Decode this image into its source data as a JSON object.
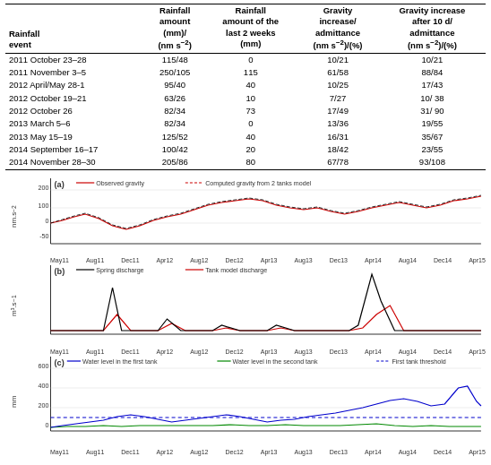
{
  "table": {
    "headers": [
      {
        "line1": "Rainfall",
        "line2": "event"
      },
      {
        "line1": "Rainfall",
        "line2": "amount",
        "line3": "(mm)/",
        "line4": "(nm s⁻²)"
      },
      {
        "line1": "Rainfall",
        "line2": "amount of the",
        "line3": "last 2 weeks",
        "line4": "(mm)"
      },
      {
        "line1": "Gravity",
        "line2": "increase/",
        "line3": "admittance",
        "line4": "(nm s⁻²)/(%)"
      },
      {
        "line1": "Gravity increase",
        "line2": "after 10 d/",
        "line3": "admittance",
        "line4": "(nm s⁻²)/(%)"
      }
    ],
    "rows": [
      [
        "2011 October 23–28",
        "115/48",
        "0",
        "10/21",
        "10/21"
      ],
      [
        "2011 November 3–5",
        "250/105",
        "115",
        "61/58",
        "88/84"
      ],
      [
        "2012 April/May 28-1",
        "95/40",
        "40",
        "10/25",
        "17/43"
      ],
      [
        "2012 October 19–21",
        "63/26",
        "10",
        "7/27",
        "10/ 38"
      ],
      [
        "2012 October 26",
        "82/34",
        "73",
        "17/49",
        "31/ 90"
      ],
      [
        "2013 March 5–6",
        "82/34",
        "0",
        "13/36",
        "19/55"
      ],
      [
        "2013 May 15–19",
        "125/52",
        "40",
        "16/31",
        "35/67"
      ],
      [
        "2014 September 16–17",
        "100/42",
        "20",
        "18/42",
        "23/55"
      ],
      [
        "2014 November 28–30",
        "205/86",
        "80",
        "67/78",
        "93/108"
      ]
    ]
  },
  "charts": {
    "a": {
      "label": "(a)",
      "y_axis": "nm.s⁻²",
      "y_max": 200,
      "y_min": -50,
      "legend": [
        {
          "color": "#cc0000",
          "label": "Observed gravity"
        },
        {
          "color": "#cc0000",
          "style": "dashed",
          "label": "Computed gravity from 2 tanks model"
        }
      ]
    },
    "b": {
      "label": "(b)",
      "y_axis": "m³.s⁻¹",
      "legend": [
        {
          "color": "#000000",
          "label": "Spring discharge"
        },
        {
          "color": "#cc0000",
          "label": "Tank model discharge"
        }
      ]
    },
    "c": {
      "label": "(c)",
      "y_axis": "mm",
      "y_max": 600,
      "legend": [
        {
          "color": "#0000cc",
          "label": "Water level in the first tank"
        },
        {
          "color": "#008800",
          "label": "Water level in the second tank"
        },
        {
          "color": "#0000cc",
          "style": "dashed",
          "label": "First tank threshold"
        }
      ]
    }
  },
  "x_axis_labels": [
    "May11",
    "Aug11",
    "Dec11",
    "Apr12",
    "Aug12",
    "Dec12",
    "Apr13",
    "Aug13",
    "Dec13",
    "Apr14",
    "Aug14",
    "Dec14",
    "Apr15"
  ]
}
